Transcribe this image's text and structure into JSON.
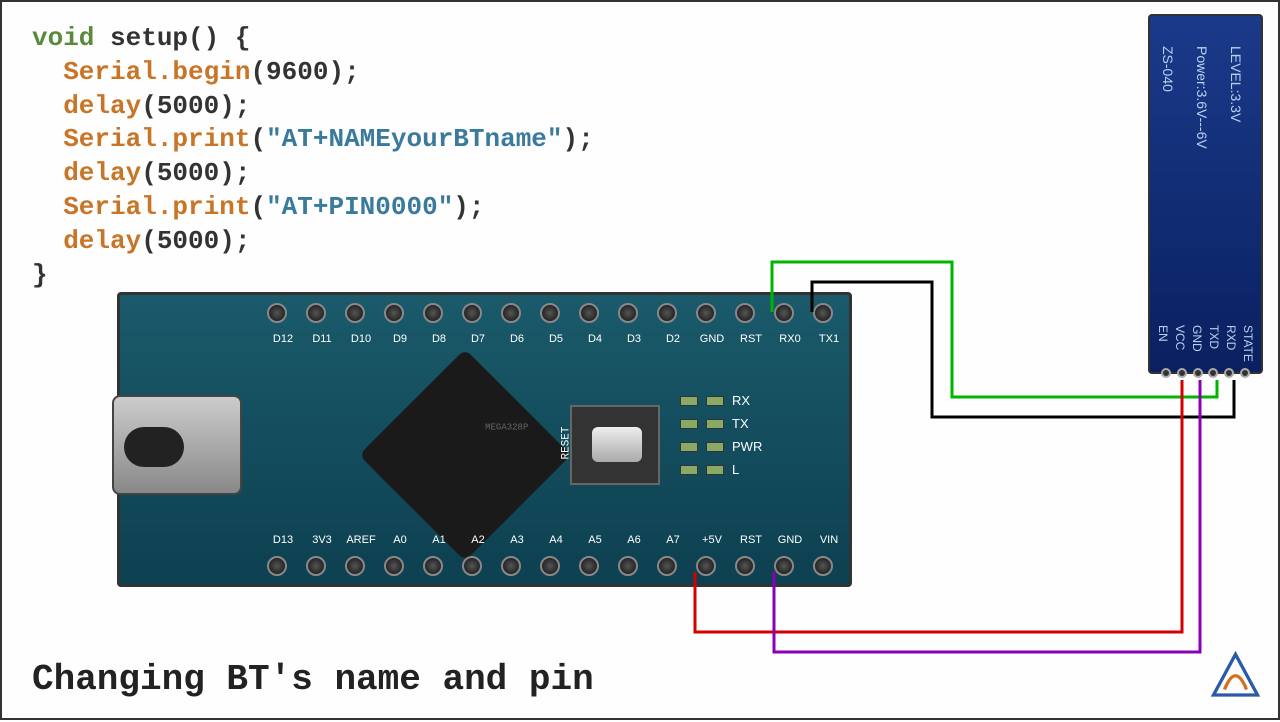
{
  "code": {
    "l1_kw": "void",
    "l1_rest": " setup() {",
    "l2_obj": "Serial",
    "l2_fn": ".begin",
    "l2_arg": "(9600);",
    "l3_fn": "delay",
    "l3_arg": "(5000);",
    "l4_obj": "Serial",
    "l4_fn": ".print",
    "l4_open": "(",
    "l4_str": "\"AT+NAMEyourBTname\"",
    "l4_close": ");",
    "l5_fn": "delay",
    "l5_arg": "(5000);",
    "l6_obj": "Serial",
    "l6_fn": ".print",
    "l6_open": "(",
    "l6_str": "\"AT+PIN0000\"",
    "l6_close": ");",
    "l7_fn": "delay",
    "l7_arg": "(5000);",
    "l8": "}"
  },
  "arduino": {
    "top_pins": [
      "D12",
      "D11",
      "D10",
      "D9",
      "D8",
      "D7",
      "D6",
      "D5",
      "D4",
      "D3",
      "D2",
      "GND",
      "RST",
      "RX0",
      "TX1"
    ],
    "bot_pins": [
      "D13",
      "3V3",
      "AREF",
      "A0",
      "A1",
      "A2",
      "A3",
      "A4",
      "A5",
      "A6",
      "A7",
      "+5V",
      "RST",
      "GND",
      "VIN"
    ],
    "chip": "MEGA328P",
    "reset": "RESET",
    "leds": [
      "RX",
      "TX",
      "PWR",
      "L"
    ]
  },
  "bt": {
    "model": "ZS-040",
    "power": "Power:3.6V---6V",
    "level": "LEVEL:3.3V",
    "pins": [
      "EN",
      "VCC",
      "GND",
      "TXD",
      "RXD",
      "STATE"
    ]
  },
  "caption": "Changing BT's name and pin",
  "wire_colors": {
    "rx_txd": "#00b400",
    "tx_rxd": "#000000",
    "vcc_5v": "#d40000",
    "gnd_gnd": "#8a00b4"
  }
}
